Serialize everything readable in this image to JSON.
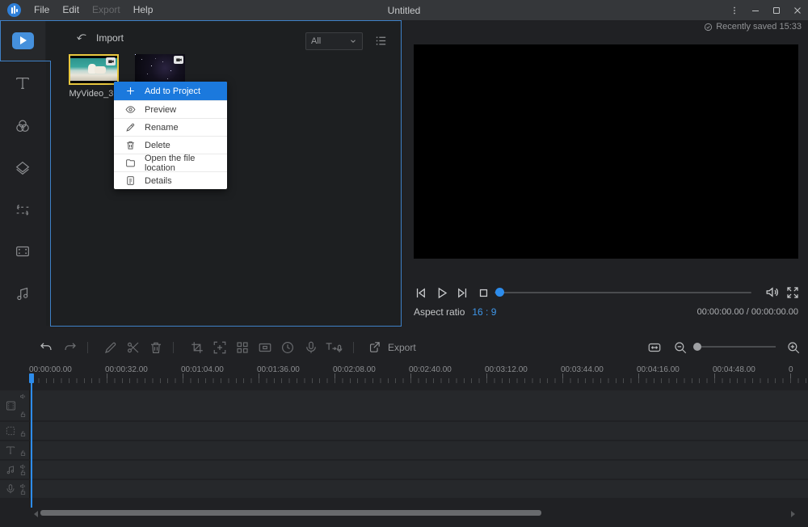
{
  "titlebar": {
    "menus": [
      {
        "label": "File",
        "enabled": true
      },
      {
        "label": "Edit",
        "enabled": true
      },
      {
        "label": "Export",
        "enabled": false
      },
      {
        "label": "Help",
        "enabled": true
      }
    ],
    "title": "Untitled"
  },
  "status": {
    "saved_text": "Recently saved 15:33"
  },
  "sidebar": {
    "tabs": [
      "media",
      "text",
      "filters",
      "overlays",
      "transitions",
      "elements",
      "music"
    ],
    "active_tab": "media"
  },
  "media": {
    "import_label": "Import",
    "filter_value": "All",
    "clips": [
      {
        "name": "MyVideo_3..",
        "selected": true
      },
      {
        "name": "",
        "selected": false
      }
    ]
  },
  "context_menu": {
    "items": [
      {
        "label": "Add to Project",
        "icon": "plus-icon",
        "highlighted": true
      },
      {
        "label": "Preview",
        "icon": "eye-icon"
      },
      {
        "label": "Rename",
        "icon": "pencil-icon"
      },
      {
        "label": "Delete",
        "icon": "trash-icon"
      },
      {
        "label": "Open the file location",
        "icon": "folder-icon"
      },
      {
        "label": "Details",
        "icon": "details-icon"
      }
    ]
  },
  "preview": {
    "aspect_label": "Aspect ratio",
    "aspect_value": "16 : 9",
    "timecode": "00:00:00.00 / 00:00:00.00"
  },
  "toolbar": {
    "export_label": "Export"
  },
  "ruler": {
    "labels": [
      "00:00:00.00",
      "00:00:32.00",
      "00:01:04.00",
      "00:01:36.00",
      "00:02:08.00",
      "00:02:40.00",
      "00:03:12.00",
      "00:03:44.00",
      "00:04:16.00",
      "00:04:48.00",
      "0"
    ]
  },
  "tracks": [
    "video-track",
    "pip-track",
    "text-track",
    "music-track",
    "voiceover-track"
  ],
  "colors": {
    "accent": "#2d8ceb",
    "menu_highlight": "#1b79dd",
    "selection_yellow": "#e8c73e",
    "titlebar_bg": "#35373a",
    "panel_bg": "#1d1f21"
  }
}
